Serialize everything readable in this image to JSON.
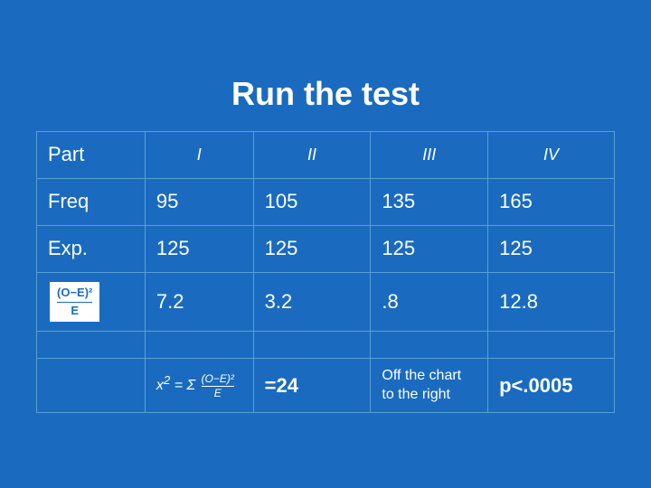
{
  "title": "Run the test",
  "table": {
    "headers": {
      "label": "Part",
      "col1": "I",
      "col2": "II",
      "col3": "III",
      "col4": "IV"
    },
    "rows": {
      "freq": {
        "label": "Freq",
        "col1": "95",
        "col2": "105",
        "col3": "135",
        "col4": "165"
      },
      "exp": {
        "label": "Exp.",
        "col1": "125",
        "col2": "125",
        "col3": "125",
        "col4": "125"
      },
      "calc": {
        "col1": "7.2",
        "col2": "3.2",
        "col3": ".8",
        "col4": "12.8"
      },
      "empty": {},
      "result": {
        "sum": "=24",
        "off_chart": "Off the chart to the right",
        "p_value": "p<.0005"
      }
    }
  }
}
